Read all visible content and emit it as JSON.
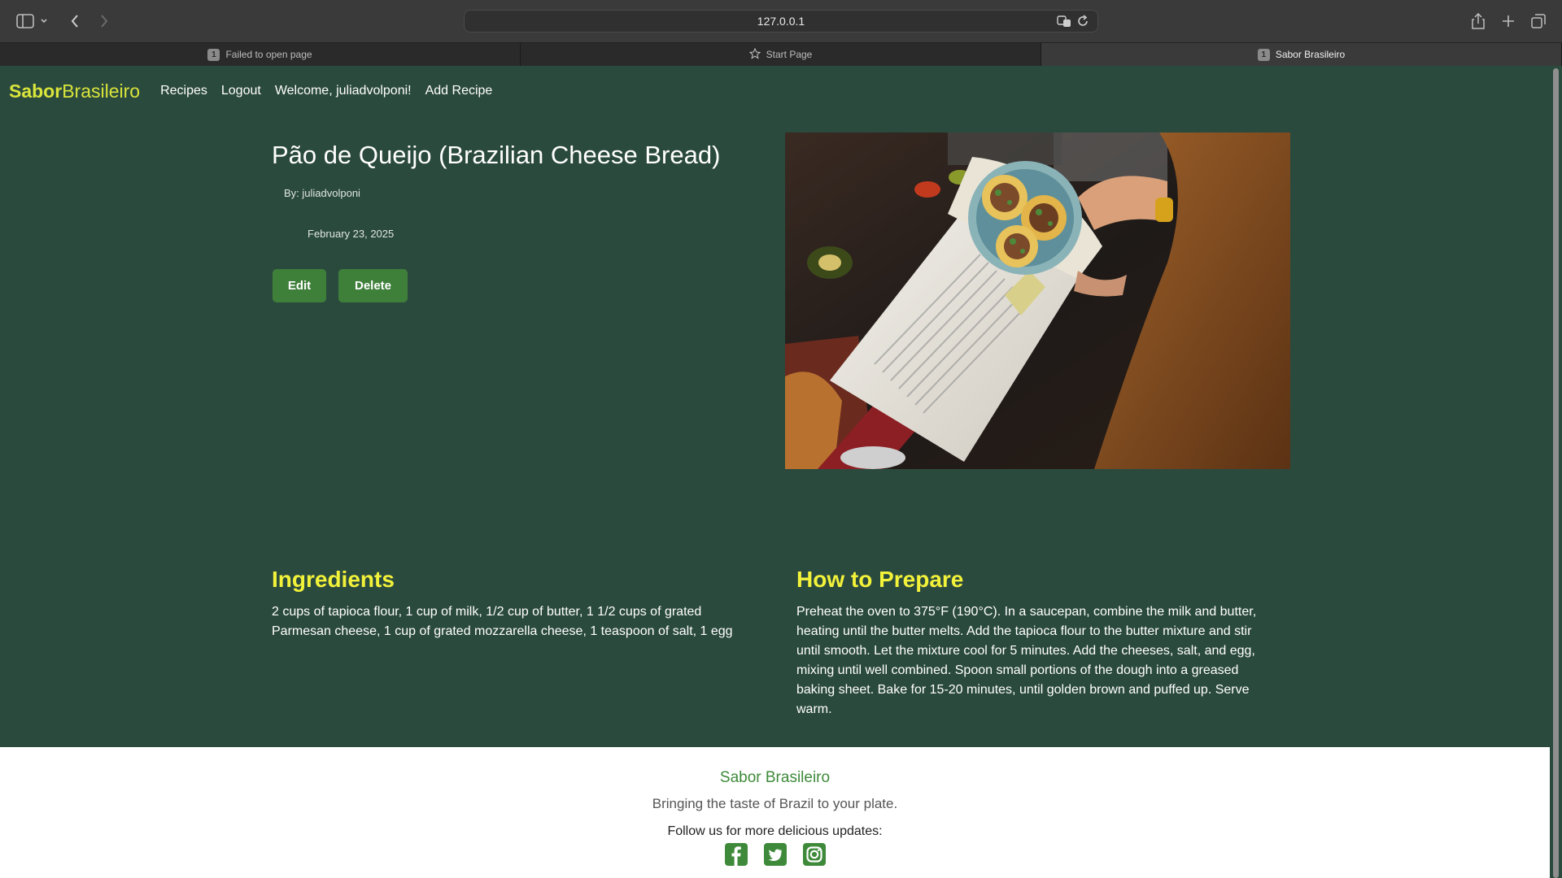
{
  "browser": {
    "url": "127.0.0.1",
    "tabs": [
      {
        "label": "Failed to open page",
        "badge": "1"
      },
      {
        "label": "Start Page"
      },
      {
        "label": "Sabor Brasileiro",
        "badge": "1"
      }
    ]
  },
  "nav": {
    "logo_bold": "Sabor",
    "logo_rest": "Brasileiro",
    "links": [
      "Recipes",
      "Logout",
      "Welcome, juliadvolponi!",
      "Add Recipe"
    ]
  },
  "recipe": {
    "title": "Pão de Queijo (Brazilian Cheese Bread)",
    "author": "By: juliadvolponi",
    "date": "February 23, 2025",
    "edit_label": "Edit",
    "delete_label": "Delete",
    "ingredients_heading": "Ingredients",
    "ingredients_text": "2 cups of tapioca flour, 1 cup of milk, 1/2 cup of butter, 1 1/2 cups of grated Parmesan cheese, 1 cup of grated mozzarella cheese, 1 teaspoon of salt, 1 egg",
    "prepare_heading": "How to Prepare",
    "prepare_text": "Preheat the oven to 375°F (190°C). In a saucepan, combine the milk and butter, heating until the butter melts. Add the tapioca flour to the butter mixture and stir until smooth. Let the mixture cool for 5 minutes. Add the cheeses, salt, and egg, mixing until well combined. Spoon small portions of the dough into a greased baking sheet. Bake for 15-20 minutes, until golden brown and puffed up. Serve warm."
  },
  "footer": {
    "title": "Sabor Brasileiro",
    "tagline": "Bringing the taste of Brazil to your plate.",
    "follow": "Follow us for more delicious updates:",
    "icons": [
      "facebook-icon",
      "twitter-icon",
      "instagram-icon"
    ]
  },
  "colors": {
    "page_bg": "#2b4a3e",
    "accent_yellow": "#f2f23a",
    "button_green": "#3e7f3a",
    "footer_title": "#3e8a3a"
  }
}
